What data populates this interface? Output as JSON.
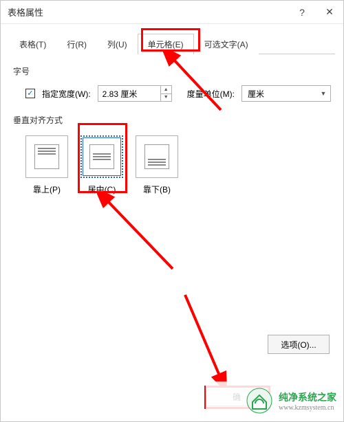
{
  "window": {
    "title": "表格属性"
  },
  "tabs": {
    "table": "表格(T)",
    "row": "行(R)",
    "column": "列(U)",
    "cell": "单元格(E)",
    "alttext": "可选文字(A)"
  },
  "size": {
    "group_label": "字号",
    "pref_width_checkbox_label": "指定宽度(W):",
    "pref_width_value": "2.83 厘米",
    "unit_label": "度量单位(M):",
    "unit_value": "厘米"
  },
  "valign": {
    "group_label": "垂直对齐方式",
    "top": "靠上(P)",
    "center": "居中(C)",
    "bottom": "靠下(B)"
  },
  "buttons": {
    "options": "选项(O)...",
    "ok": "确"
  },
  "watermark": {
    "zh": "纯净系统之家",
    "en": "www.kzmsystem.cn"
  }
}
